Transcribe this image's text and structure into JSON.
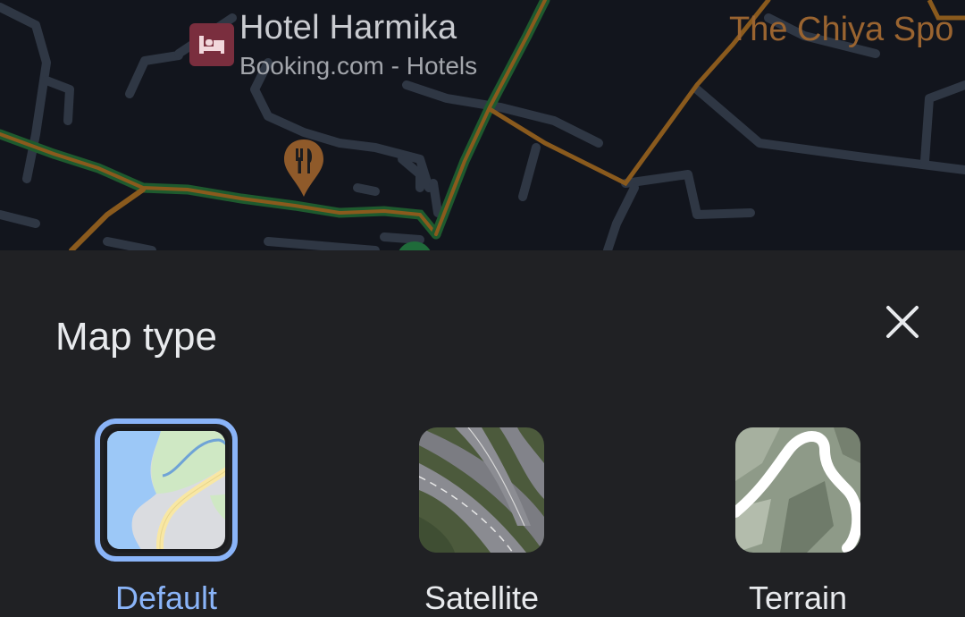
{
  "map": {
    "places": {
      "hotel_name": "Hotel Harmika",
      "hotel_source": "Booking.com - Hotels",
      "right_place": "The Chiya Spo"
    },
    "icons": [
      "bed-icon",
      "restaurant-pin-icon"
    ]
  },
  "sheet": {
    "title": "Map type",
    "close_icon": "close-icon",
    "types": [
      {
        "label": "Default",
        "selected": true
      },
      {
        "label": "Satellite",
        "selected": false
      },
      {
        "label": "Terrain",
        "selected": false
      }
    ]
  },
  "colors": {
    "accent": "#8ab4f8",
    "sheet_bg": "#202124",
    "map_bg": "#12151d"
  }
}
